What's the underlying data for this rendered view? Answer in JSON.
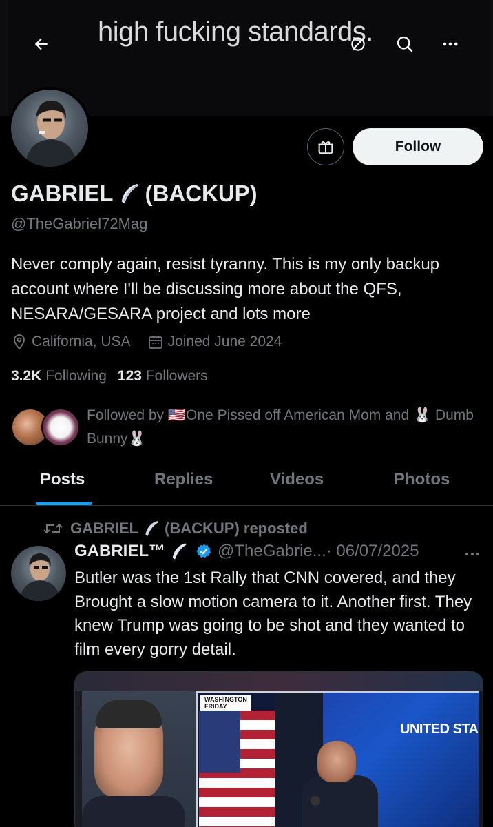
{
  "header": {
    "banner_text": "high fucking standards.",
    "icons": [
      "back-arrow-icon",
      "cast-off-icon",
      "search-icon",
      "more-icon"
    ]
  },
  "profile": {
    "display_name_first": "GABRIEL",
    "display_name_second": "(BACKUP)",
    "handle": "@TheGabriel72Mag",
    "bio": "Never comply again, resist tyranny. This is my only backup account where I'll be discussing more about the QFS, NESARA/GESARA project and lots more",
    "location": "California, USA",
    "joined": "Joined June 2024",
    "following_count": "3.2K",
    "following_label": "Following",
    "followers_count": "123",
    "followers_label": "Followers",
    "followed_by_text": "Followed by 🇺🇸One Pissed off American Mom and 🐰 Dumb Bunny🐰",
    "follow_button": "Follow"
  },
  "tabs": [
    "Posts",
    "Replies",
    "Videos",
    "Photos"
  ],
  "active_tab": "Posts",
  "post": {
    "repost_by_first": "GABRIEL",
    "repost_by_second": "(BACKUP) reposted",
    "author_name": "GABRIEL™",
    "author_handle": "@TheGabrie...",
    "date": "· 06/07/2025",
    "text": "Butler was the 1st Rally that CNN covered,  and they Brought a slow motion camera to it. Another first. They knew Trump was going to be shot and they wanted to film every gorry detail.",
    "media_label_line1": "WASHINGTON",
    "media_label_line2": "FRIDAY",
    "media_overlay_text": "UNITED STA"
  },
  "colors": {
    "background": "#000000",
    "text_primary": "#e7e9ea",
    "text_secondary": "#71767b",
    "accent": "#1d9bf0",
    "follow_bg": "#eff3f4"
  }
}
